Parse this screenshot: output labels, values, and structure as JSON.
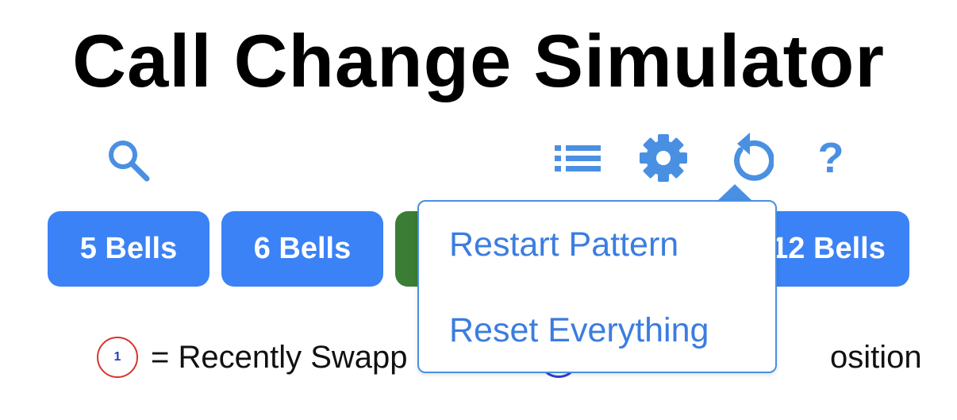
{
  "header": {
    "title": "Call Change Simulator"
  },
  "toolbar": {
    "search_icon": "search-icon",
    "list_icon": "list-icon",
    "settings_icon": "gear-icon",
    "restart_icon": "restart-icon",
    "help_icon": "help-icon",
    "help_glyph": "?",
    "icon_color": "#4a90e2"
  },
  "bells": {
    "buttons": [
      {
        "label": "5 Bells",
        "color": "#3b82f6"
      },
      {
        "label": "6 Bells",
        "color": "#3b82f6"
      },
      {
        "label": "",
        "color": "#3c7d35"
      },
      {
        "label": "12 Bells",
        "color": "#3b82f6"
      }
    ]
  },
  "legend": {
    "swapped": {
      "number": "1",
      "text": "= Recently Swapp"
    },
    "home": {
      "text": "osition"
    }
  },
  "restart_menu": {
    "items": [
      {
        "label": "Restart Pattern"
      },
      {
        "label": "Reset Everything"
      }
    ]
  }
}
